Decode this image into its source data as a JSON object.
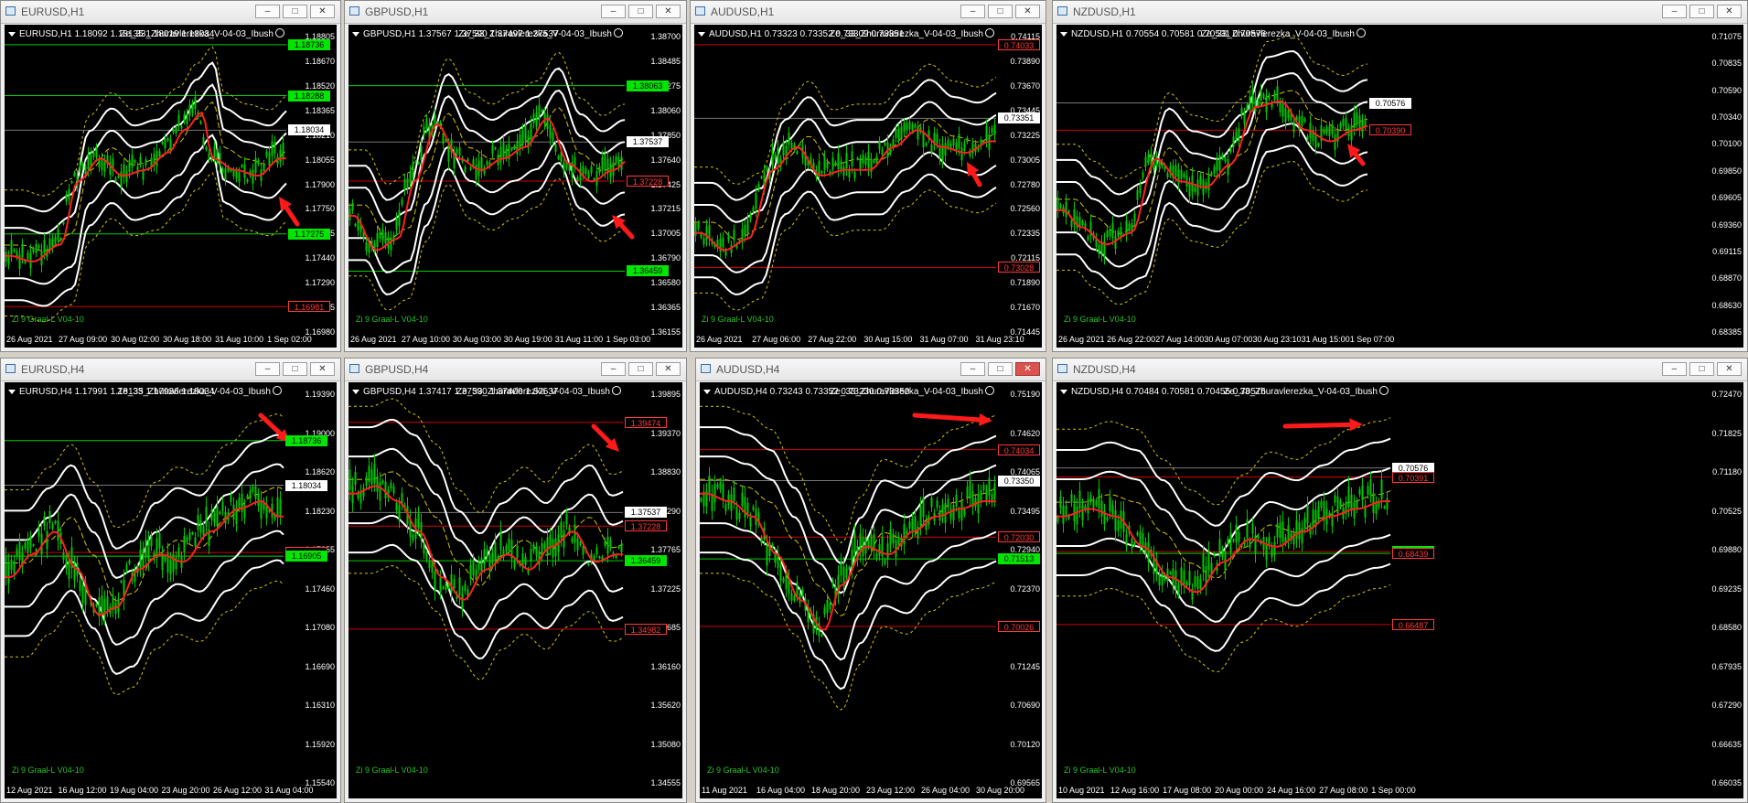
{
  "windows": [
    {
      "id": "eurusd-h1",
      "title": "EURUSD,H1",
      "header": "EURUSD,H1  1.18092 1.18135 1.18019 1.18034",
      "indicator": "Ze_33_Zhuravlerezka_V-04-03_Ibush",
      "footer": "Zi 9 Graal-L V04-10",
      "yticks": [
        "1.18805",
        "1.18670",
        "1.18520",
        "1.18365",
        "1.18210",
        "1.18055",
        "1.17900",
        "1.17750",
        "1.17595",
        "1.17440",
        "1.17290",
        "1.17135",
        "1.16980"
      ],
      "xticks": [
        "26 Aug 2021",
        "27 Aug 09:00",
        "30 Aug 02:00",
        "30 Aug 18:00",
        "31 Aug 10:00",
        "1 Sep 02:00"
      ],
      "price_labels": [
        {
          "text": "1.18736",
          "color": "green"
        },
        {
          "text": "1.18288",
          "color": "green"
        },
        {
          "text": "1.18034",
          "color": "white"
        },
        {
          "text": "1.17275",
          "color": "green"
        },
        {
          "text": "1.16981",
          "color": "red"
        }
      ]
    },
    {
      "id": "gbpusd-h1",
      "title": "GBPUSD,H1",
      "header": "GBPUSD,H1  1.37567 1.37590 1.37497 1.37537",
      "indicator": "Ze_33_Zhuravlerezka_V-04-03_Ibush",
      "footer": "Zi 9 Graal-L V04-10",
      "yticks": [
        "1.38700",
        "1.38485",
        "1.38275",
        "1.38060",
        "1.37850",
        "1.37640",
        "1.37425",
        "1.37215",
        "1.37005",
        "1.36790",
        "1.36580",
        "1.36365",
        "1.36155"
      ],
      "xticks": [
        "26 Aug 2021",
        "27 Aug 10:00",
        "30 Aug 03:00",
        "30 Aug 19:00",
        "31 Aug 11:00",
        "1 Sep 03:00"
      ],
      "price_labels": [
        {
          "text": "1.38063",
          "color": "green"
        },
        {
          "text": "1.37537",
          "color": "white"
        },
        {
          "text": "1.37228",
          "color": "red"
        },
        {
          "text": "1.36459",
          "color": "green"
        }
      ]
    },
    {
      "id": "audusd-h1",
      "title": "AUDUSD,H1",
      "header": "AUDUSD,H1  0.73323 0.73352 0.73309 0.73351",
      "indicator": "Ze_33_Zhuravlerezka_V-04-03_Ibush",
      "footer": "Zi 9 Graal-L V04-10",
      "yticks": [
        "0.74115",
        "0.73890",
        "0.73670",
        "0.73445",
        "0.73225",
        "0.73005",
        "0.72780",
        "0.72560",
        "0.72335",
        "0.72115",
        "0.71890",
        "0.71670",
        "0.71445"
      ],
      "xticks": [
        "26 Aug 2021",
        "27 Aug 06:00",
        "27 Aug 22:00",
        "30 Aug 15:00",
        "31 Aug 07:00",
        "31 Aug 23:10"
      ],
      "price_labels": [
        {
          "text": "0.74033",
          "color": "red"
        },
        {
          "text": "0.73351",
          "color": "white"
        },
        {
          "text": "0.73028",
          "color": "red"
        }
      ]
    },
    {
      "id": "nzdusd-h1",
      "title": "NZDUSD,H1",
      "header": "NZDUSD,H1  0.70554 0.70581 0.70531 0.70576",
      "indicator": "Ze_33_Zhuravlerezka_V-04-03_Ibush",
      "footer": "Zi 9 Graal-L V04-10",
      "yticks": [
        "0.71075",
        "0.70835",
        "0.70590",
        "0.70340",
        "0.70100",
        "0.69850",
        "0.69605",
        "0.69360",
        "0.69115",
        "0.68870",
        "0.68630",
        "0.68385"
      ],
      "xticks": [
        "26 Aug 2021",
        "26 Aug 22:00",
        "27 Aug 14:00",
        "30 Aug 07:00",
        "30 Aug 23:10",
        "31 Aug 15:00",
        "1 Sep 07:00"
      ],
      "price_labels": [
        {
          "text": "0.70576",
          "color": "white"
        },
        {
          "text": "0.70390",
          "color": "red"
        }
      ]
    },
    {
      "id": "eurusd-h4",
      "title": "EURUSD,H4",
      "header": "EURUSD,H4  1.17991 1.18135 1.17936 1.18034",
      "indicator": "Ze_33_Zhuravlerezka_V-04-03_Ibush",
      "footer": "Zi 9 Graal-L V04-10",
      "yticks": [
        "1.19390",
        "1.19000",
        "1.18620",
        "1.18230",
        "1.17855",
        "1.17460",
        "1.17080",
        "1.16690",
        "1.16310",
        "1.15920",
        "1.15540"
      ],
      "xticks": [
        "12 Aug 2021",
        "16 Aug 12:00",
        "19 Aug 04:00",
        "23 Aug 20:00",
        "26 Aug 12:00",
        "31 Aug 04:00"
      ],
      "price_labels": [
        {
          "text": "1.18736",
          "color": "green"
        },
        {
          "text": "1.18034",
          "color": "white"
        },
        {
          "text": "1.16981",
          "color": "red"
        },
        {
          "text": "1.16905",
          "color": "green"
        }
      ]
    },
    {
      "id": "gbpusd-h4",
      "title": "GBPUSD,H4",
      "header": "GBPUSD,H4  1.37417 1.37590 1.37400 1.37537",
      "indicator": "Ze_33_Zhuravlerezka_V-04-03_Ibush",
      "footer": "Zi 9 Graal-L V04-10",
      "yticks": [
        "1.39895",
        "1.39370",
        "1.38830",
        "1.38290",
        "1.37765",
        "1.37225",
        "1.36685",
        "1.36160",
        "1.35620",
        "1.35080",
        "1.34555"
      ],
      "xticks": [
        "",
        ""
      ],
      "price_labels": [
        {
          "text": "1.39474",
          "color": "red"
        },
        {
          "text": "1.37537",
          "color": "white"
        },
        {
          "text": "1.37228",
          "color": "red"
        },
        {
          "text": "1.36459",
          "color": "green"
        },
        {
          "text": "1.34982",
          "color": "red"
        }
      ]
    },
    {
      "id": "audusd-h4",
      "title": "AUDUSD,H4",
      "header": "AUDUSD,H4  0.73243 0.73352 0.73230 0.73350",
      "indicator": "Ze_33_Zhuravlerezka_V-04-03_Ibush",
      "footer": "Zi 9 Graal-L V04-10",
      "yticks": [
        "0.75190",
        "0.74620",
        "0.74065",
        "0.73495",
        "0.72940",
        "0.72370",
        "0.71815",
        "0.71245",
        "0.70690",
        "0.70120",
        "0.69565"
      ],
      "xticks": [
        "11 Aug 2021",
        "16 Aug 04:00",
        "18 Aug 20:00",
        "23 Aug 12:00",
        "26 Aug 04:00",
        "30 Aug 20:00"
      ],
      "price_labels": [
        {
          "text": "0.74034",
          "color": "red"
        },
        {
          "text": "0.73350",
          "color": "white"
        },
        {
          "text": "0.72030",
          "color": "red"
        },
        {
          "text": "0.71513",
          "color": "green"
        },
        {
          "text": "0.70026",
          "color": "red"
        }
      ]
    },
    {
      "id": "nzdusd-h4",
      "title": "NZDUSD,H4",
      "header": "NZDUSD,H4  0.70484 0.70581 0.70455 0.70576",
      "indicator": "Ze_33_Zhuravlerezka_V-04-03_Ibush",
      "footer": "Zi 9 Graal-L V04-10",
      "yticks": [
        "0.72470",
        "0.71825",
        "0.71180",
        "0.70525",
        "0.69880",
        "0.69235",
        "0.68580",
        "0.67935",
        "0.67290",
        "0.66635",
        "0.66035"
      ],
      "xticks": [
        "10 Aug 2021",
        "12 Aug 16:00",
        "17 Aug 08:00",
        "20 Aug 00:00",
        "24 Aug 16:00",
        "27 Aug 08:00",
        "1 Sep 00:00"
      ],
      "price_labels": [
        {
          "text": "0.70576",
          "color": "white"
        },
        {
          "text": "0.70391",
          "color": "red"
        },
        {
          "text": "0.68478",
          "color": "green"
        },
        {
          "text": "0.68439",
          "color": "red"
        },
        {
          "text": "0.66487",
          "color": "red"
        }
      ]
    }
  ],
  "window_buttons": {
    "minimize": "–",
    "maximize": "□",
    "close": "✕"
  },
  "colors": {
    "candle": "#00c800",
    "ma": "#ff2020",
    "band": "#ffffff",
    "dotted": "#d4c400",
    "arrow": "#ff1a1a"
  }
}
